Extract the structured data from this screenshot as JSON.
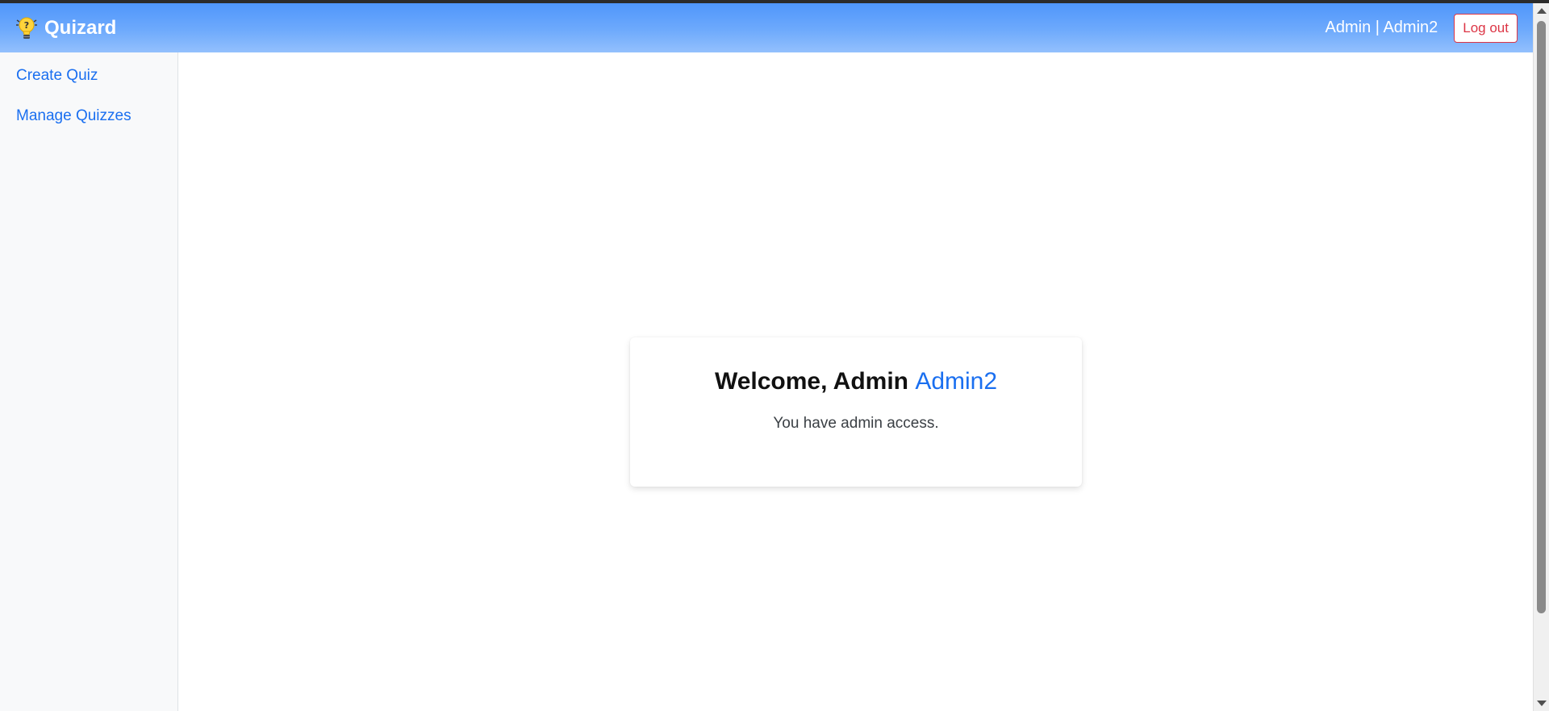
{
  "app": {
    "brand_name": "Quizard",
    "brand_icon": "lightbulb-question-icon"
  },
  "header": {
    "user_label": "Admin | Admin2",
    "logout_label": "Log out"
  },
  "sidebar": {
    "items": [
      {
        "label": "Create Quiz"
      },
      {
        "label": "Manage Quizzes"
      }
    ]
  },
  "main": {
    "welcome_prefix": "Welcome, Admin ",
    "welcome_name": "Admin2",
    "subtitle": "You have admin access."
  },
  "colors": {
    "header_gradient_start": "#4f96fb",
    "header_gradient_end": "#93c0fd",
    "link": "#1a6ff0",
    "logout": "#dc3545",
    "sidebar_bg": "#f8f9fa"
  }
}
